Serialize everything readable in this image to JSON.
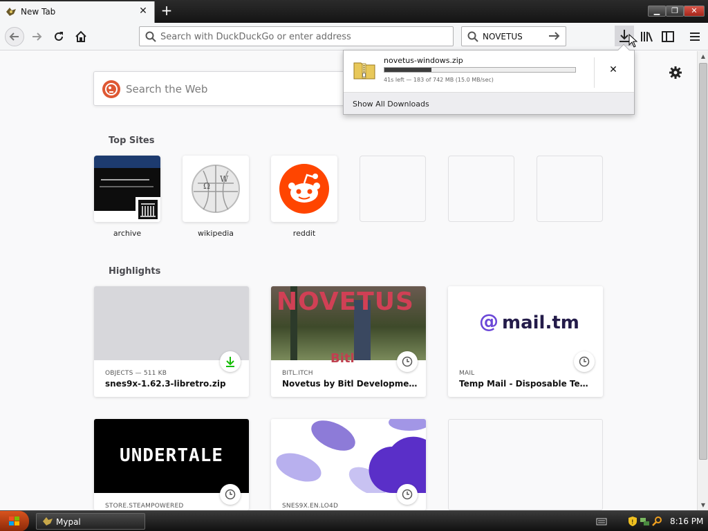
{
  "tab": {
    "title": "New Tab",
    "close": "✕"
  },
  "new_tab": "+",
  "window_controls": {
    "minimize": "▁",
    "maximize": "❐",
    "close": "✕"
  },
  "nav": {
    "url_placeholder": "Search with DuckDuckGo or enter address",
    "search_value": "NOVETUS"
  },
  "newtab_page": {
    "search_placeholder": "Search the Web",
    "top_sites_title": "Top Sites",
    "top_sites": [
      {
        "label": "archive"
      },
      {
        "label": "wikipedia"
      },
      {
        "label": "reddit"
      }
    ],
    "highlights_title": "Highlights",
    "highlights": [
      {
        "context": "OBJECTS — 511 KB",
        "title": "snes9x-1.62.3-libretro.zip",
        "icon": "download-icon"
      },
      {
        "context": "BITL.ITCH",
        "title": "Novetus by Bitl Development Studio",
        "icon": "clock-icon",
        "thumb_text": "NOVETUS",
        "thumb_sub": "Bitl"
      },
      {
        "context": "MAIL",
        "title": "Temp Mail - Disposable Temporary Email",
        "icon": "clock-icon",
        "thumb_text": "mail.tm"
      },
      {
        "context": "STORE.STEAMPOWERED",
        "title": "",
        "icon": "clock-icon",
        "thumb_text": "UNDERTALE"
      },
      {
        "context": "SNES9X.EN.LO4D",
        "title": "",
        "icon": "clock-icon"
      }
    ]
  },
  "downloads_panel": {
    "filename": "novetus-windows.zip",
    "progress": 0.247,
    "status": "41s left — 183 of 742 MB (15.0 MB/sec)",
    "cancel": "✕",
    "show_all": "Show All Downloads"
  },
  "taskbar": {
    "app": "Mypal",
    "time": "8:16 PM"
  },
  "colors": {
    "reddit": "#ff4500",
    "ddg": "#de5833",
    "mail_tm": "#6b47d8",
    "download_green": "#12bc00"
  }
}
